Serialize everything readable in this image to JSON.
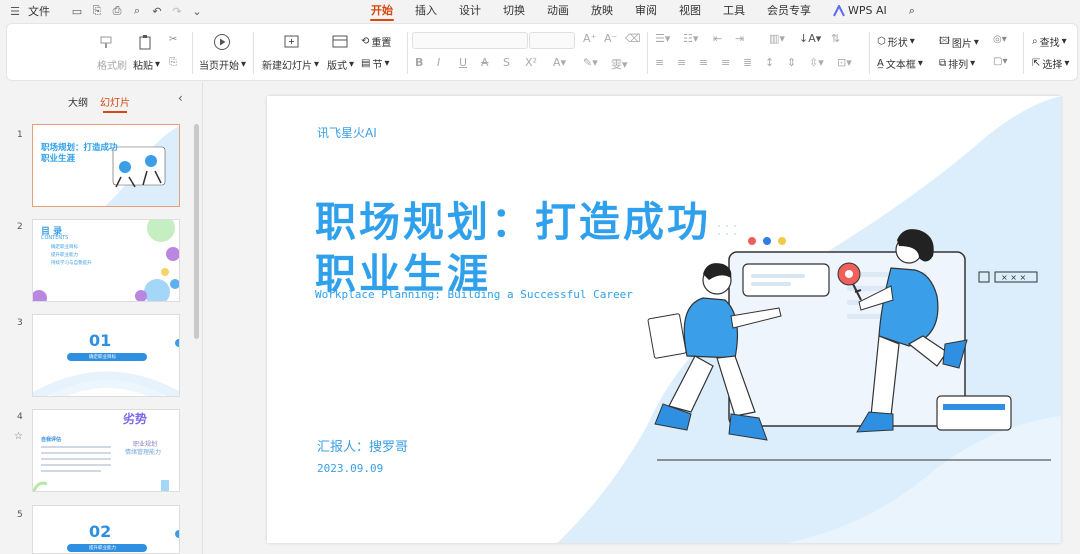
{
  "menubar": {
    "menu_label": "文件",
    "ai_label": "WPS AI"
  },
  "tabs": [
    {
      "label": "开始",
      "active": true
    },
    {
      "label": "插入"
    },
    {
      "label": "设计"
    },
    {
      "label": "切换"
    },
    {
      "label": "动画"
    },
    {
      "label": "放映"
    },
    {
      "label": "审阅"
    },
    {
      "label": "视图"
    },
    {
      "label": "工具"
    },
    {
      "label": "会员专享"
    }
  ],
  "ribbon": {
    "format_painter": "格式刷",
    "paste": "粘贴",
    "start_from_current": "当页开始",
    "new_slide": "新建幻灯片",
    "layout": "版式",
    "reset": "重置",
    "section": "节",
    "shape": "形状",
    "picture": "图片",
    "textbox": "文本框",
    "arrange": "排列",
    "find": "查找",
    "select": "选择"
  },
  "panel": {
    "outline_tab": "大纲",
    "slides_tab": "幻灯片"
  },
  "thumbs": [
    {
      "num": "1",
      "title": "职场规划：打造成功职业生涯"
    },
    {
      "num": "2",
      "title": "目 录",
      "sub": "CONTENTS",
      "items": [
        "确定职业目标",
        "提升职业能力",
        "持续学习与自我提升"
      ]
    },
    {
      "num": "3",
      "title": "01",
      "sub": "确定职业目标"
    },
    {
      "num": "4",
      "title": "自我评估",
      "sub": "劣势"
    },
    {
      "num": "5",
      "title": "02",
      "sub": "提升职业能力"
    }
  ],
  "slide": {
    "brand": "讯飞星火AI",
    "title_line1": "职场规划：打造成功",
    "title_line2": "职业生涯",
    "subtitle": "Workplace Planning: Building a Successful Career",
    "reporter": "汇报人：搜罗哥",
    "date": "2023.09.09"
  },
  "colors": {
    "accent": "#d9480f",
    "brand_blue": "#2fa0ec",
    "light_blue": "#dceefb"
  }
}
